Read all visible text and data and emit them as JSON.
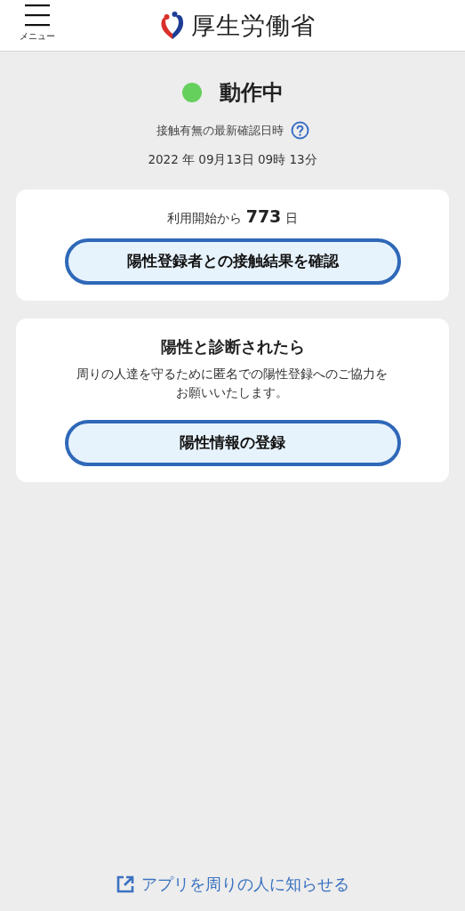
{
  "header": {
    "menu_label": "メニュー",
    "logo_text": "厚生労働省"
  },
  "status": {
    "label": "動作中",
    "color": "#66d05c",
    "check_caption": "接触有無の最新確認日時",
    "last_checked": "2022 年 09月13日 09時 13分"
  },
  "cards": [
    {
      "kind": "usage",
      "text": "利用開始から **773** 日",
      "button": "陽性登録者との接触結果を確認"
    },
    {
      "kind": "register",
      "title": "陽性と診断されたら",
      "text": "周りの人達を守るために匿名での陽性登録へのご協力をお願いいたします。",
      "button": "陽性情報の登録"
    }
  ],
  "share_link": "アプリを周りの人に知らせる"
}
